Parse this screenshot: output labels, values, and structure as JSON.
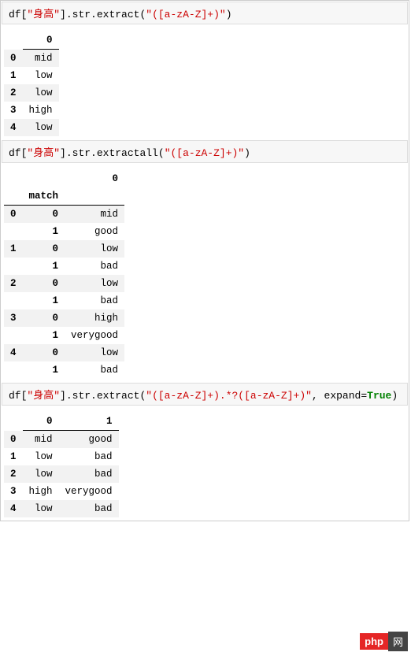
{
  "code1": {
    "var": "df",
    "key": "\"身高\"",
    "chain": ".str.extract",
    "arg": "\"([a-zA-Z]+)\""
  },
  "table1": {
    "col": "0",
    "rows": [
      {
        "idx": "0",
        "v": "mid"
      },
      {
        "idx": "1",
        "v": "low"
      },
      {
        "idx": "2",
        "v": "low"
      },
      {
        "idx": "3",
        "v": "high"
      },
      {
        "idx": "4",
        "v": "low"
      }
    ]
  },
  "code2": {
    "var": "df",
    "key": "\"身高\"",
    "chain": ".str.extractall",
    "arg": "\"([a-zA-Z]+)\""
  },
  "table2": {
    "col": "0",
    "idxname": "match",
    "rows": [
      {
        "l0": "0",
        "l1": "0",
        "v": "mid"
      },
      {
        "l0": "",
        "l1": "1",
        "v": "good"
      },
      {
        "l0": "1",
        "l1": "0",
        "v": "low"
      },
      {
        "l0": "",
        "l1": "1",
        "v": "bad"
      },
      {
        "l0": "2",
        "l1": "0",
        "v": "low"
      },
      {
        "l0": "",
        "l1": "1",
        "v": "bad"
      },
      {
        "l0": "3",
        "l1": "0",
        "v": "high"
      },
      {
        "l0": "",
        "l1": "1",
        "v": "verygood"
      },
      {
        "l0": "4",
        "l1": "0",
        "v": "low"
      },
      {
        "l0": "",
        "l1": "1",
        "v": "bad"
      }
    ]
  },
  "code3": {
    "var": "df",
    "key": "\"身高\"",
    "chain": ".str.extract",
    "arg": "\"([a-zA-Z]+).*?([a-zA-Z]+)\"",
    "sep": ", ",
    "kw": "expand",
    "eq": "=",
    "val": "True"
  },
  "table3": {
    "col0": "0",
    "col1": "1",
    "rows": [
      {
        "idx": "0",
        "c0": "mid",
        "c1": "good"
      },
      {
        "idx": "1",
        "c0": "low",
        "c1": "bad"
      },
      {
        "idx": "2",
        "c0": "low",
        "c1": "bad"
      },
      {
        "idx": "3",
        "c0": "high",
        "c1": "verygood"
      },
      {
        "idx": "4",
        "c0": "low",
        "c1": "bad"
      }
    ]
  },
  "watermark": {
    "left": "php",
    "right": "网"
  }
}
